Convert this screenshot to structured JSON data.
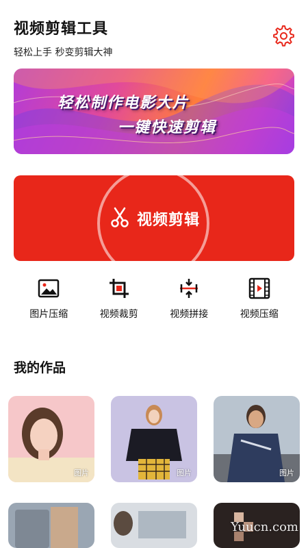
{
  "header": {
    "title": "视频剪辑工具",
    "subtitle": "轻松上手  秒变剪辑大神",
    "settings_icon": "gear-icon"
  },
  "banner": {
    "line1": "轻松制作电影大片",
    "line2": "一键快速剪辑"
  },
  "edit_card": {
    "label": "视频剪辑",
    "icon": "scissors-icon",
    "color": "#e8271a"
  },
  "tools": [
    {
      "label": "图片压缩",
      "icon": "image-icon"
    },
    {
      "label": "视频裁剪",
      "icon": "crop-icon"
    },
    {
      "label": "视频拼接",
      "icon": "merge-icon"
    },
    {
      "label": "视频压缩",
      "icon": "film-icon"
    }
  ],
  "works": {
    "title": "我的作品",
    "items": [
      {
        "tag": "图片"
      },
      {
        "tag": "图片"
      },
      {
        "tag": "图片"
      },
      {
        "tag": ""
      },
      {
        "tag": ""
      },
      {
        "tag": ""
      }
    ]
  },
  "watermark": "Yuucn.com",
  "accent_color": "#e8271a"
}
